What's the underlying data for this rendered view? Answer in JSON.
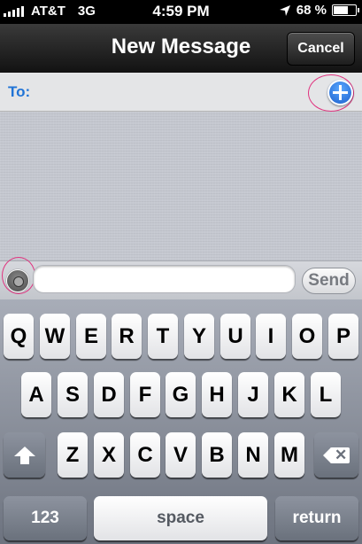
{
  "status_bar": {
    "carrier": "AT&T",
    "network": "3G",
    "time": "4:59 PM",
    "battery": "68 %",
    "battery_level": 0.68,
    "icons": [
      "signal-bars-icon",
      "location-arrow-icon",
      "battery-icon"
    ]
  },
  "navbar": {
    "title": "New Message",
    "cancel_label": "Cancel"
  },
  "to_field": {
    "label": "To:",
    "value": "",
    "add_icon": "plus-circle-icon"
  },
  "compose": {
    "camera_icon": "camera-icon",
    "message_value": "",
    "send_label": "Send"
  },
  "keyboard": {
    "row1": [
      "Q",
      "W",
      "E",
      "R",
      "T",
      "Y",
      "U",
      "I",
      "O",
      "P"
    ],
    "row2": [
      "A",
      "S",
      "D",
      "F",
      "G",
      "H",
      "J",
      "K",
      "L"
    ],
    "row3": [
      "Z",
      "X",
      "C",
      "V",
      "B",
      "N",
      "M"
    ],
    "numbers_label": "123",
    "space_label": "space",
    "return_label": "return",
    "shift_icon": "shift-arrow-icon",
    "backspace_icon": "backspace-icon"
  },
  "colors": {
    "accent_blue": "#1f73d6",
    "annotation_ring": "#e0337f"
  }
}
